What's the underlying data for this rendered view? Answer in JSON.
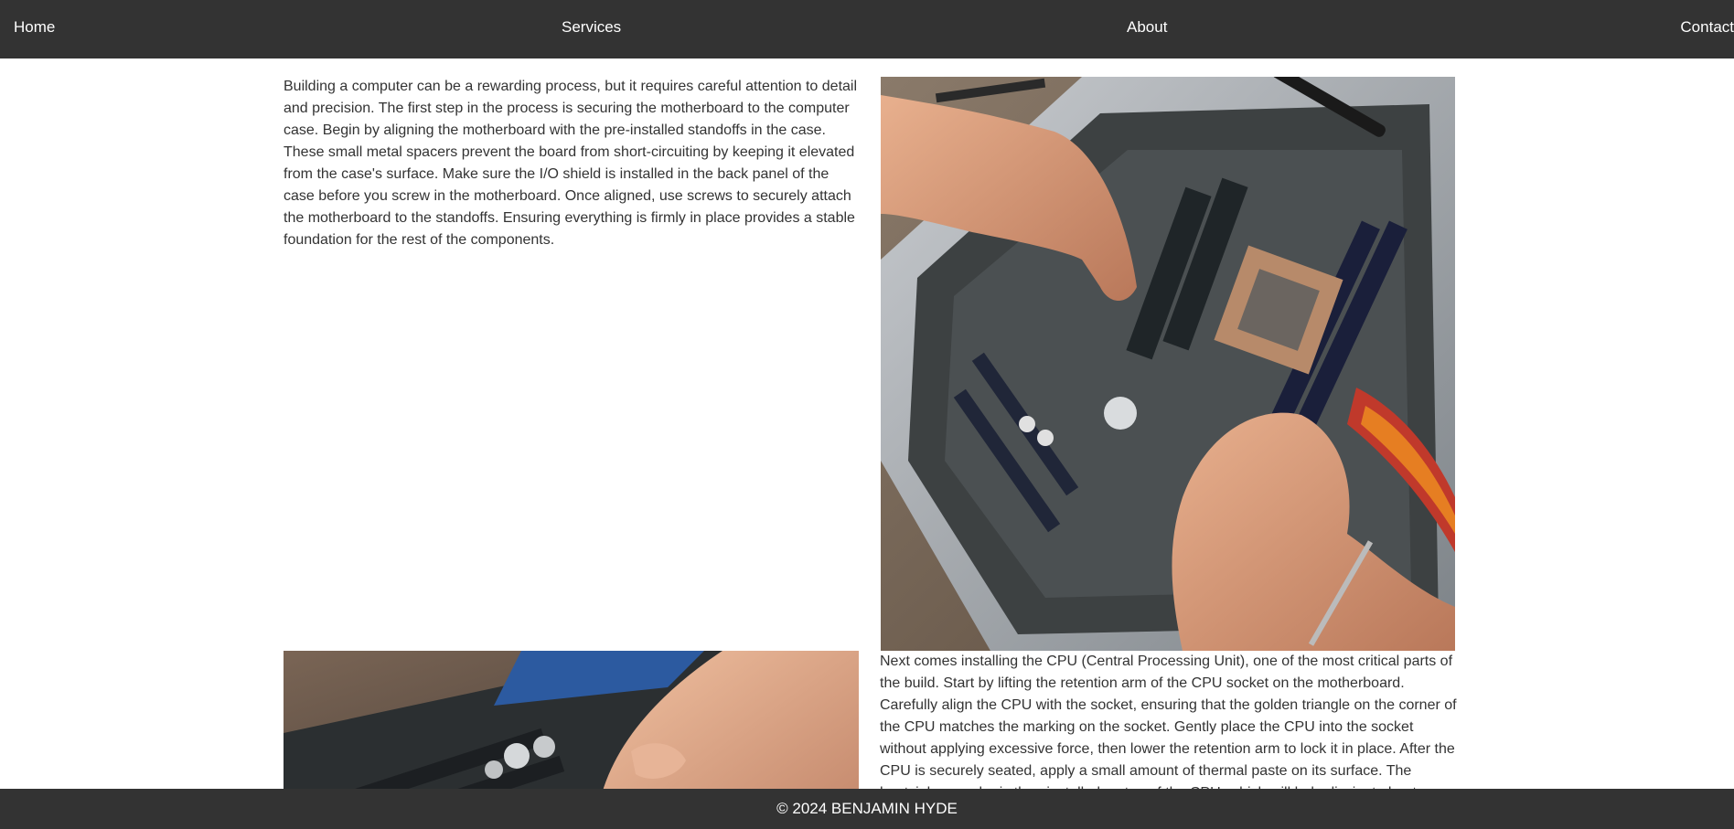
{
  "nav": {
    "home": "Home",
    "services": "Services",
    "about": "About",
    "contact": "Contact"
  },
  "main": {
    "paragraph1": "Building a computer can be a rewarding process, but it requires careful attention to detail and precision. The first step in the process is securing the motherboard to the computer case. Begin by aligning the motherboard with the pre-installed standoffs in the case. These small metal spacers prevent the board from short-circuiting by keeping it elevated from the case's surface. Make sure the I/O shield is installed in the back panel of the case before you screw in the motherboard. Once aligned, use screws to securely attach the motherboard to the standoffs. Ensuring everything is firmly in place provides a stable foundation for the rest of the components.",
    "paragraph2": "Next comes installing the CPU (Central Processing Unit), one of the most critical parts of the build. Start by lifting the retention arm of the CPU socket on the motherboard. Carefully align the CPU with the socket, ensuring that the golden triangle on the corner of the CPU matches the marking on the socket. Gently place the CPU into the socket without applying excessive force, then lower the retention arm to lock it in place. After the CPU is securely seated, apply a small amount of thermal paste on its surface. The heatsink or cooler is then installed on top of the CPU, which will help dissipate heat during operation."
  },
  "footer": {
    "copyright": "© 2024 BENJAMIN HYDE"
  }
}
